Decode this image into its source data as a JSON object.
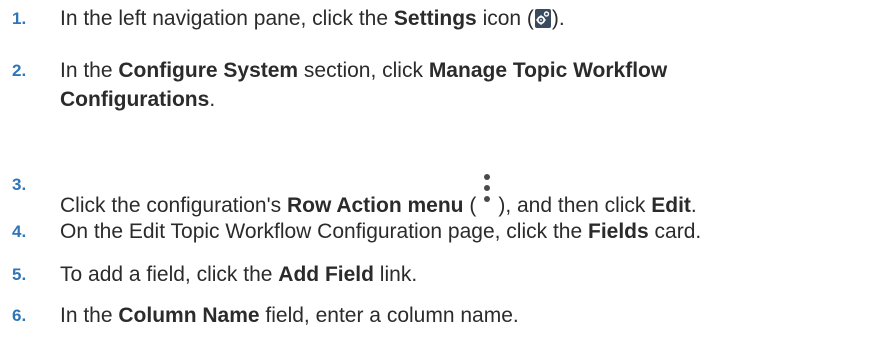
{
  "steps": [
    {
      "number": "1.",
      "parts": [
        "In the left navigation pane, click the ",
        "Settings",
        " icon (",
        ")."
      ],
      "icon": "gear-settings-icon"
    },
    {
      "number": "2.",
      "parts": [
        "In the ",
        "Configure System",
        " section, click ",
        "Manage Topic Workflow",
        "Configurations",
        "."
      ]
    },
    {
      "number": "3.",
      "parts": [
        "Click the configuration's ",
        "Row Action menu",
        " (",
        "), and then click ",
        "Edit",
        "."
      ],
      "icon": "vertical-ellipsis-icon"
    },
    {
      "number": "4.",
      "parts": [
        "On the Edit Topic Workflow Configuration page, click the ",
        "Fields",
        " card."
      ]
    },
    {
      "number": "5.",
      "parts": [
        "To add a field, click the ",
        "Add Field",
        " link."
      ]
    },
    {
      "number": "6.",
      "parts": [
        "In the ",
        "Column Name",
        " field, enter a column name."
      ]
    }
  ],
  "colors": {
    "step_number": "#2e76b8",
    "text": "#2b2b2b",
    "settings_icon_bg": "#3a4a5f"
  }
}
